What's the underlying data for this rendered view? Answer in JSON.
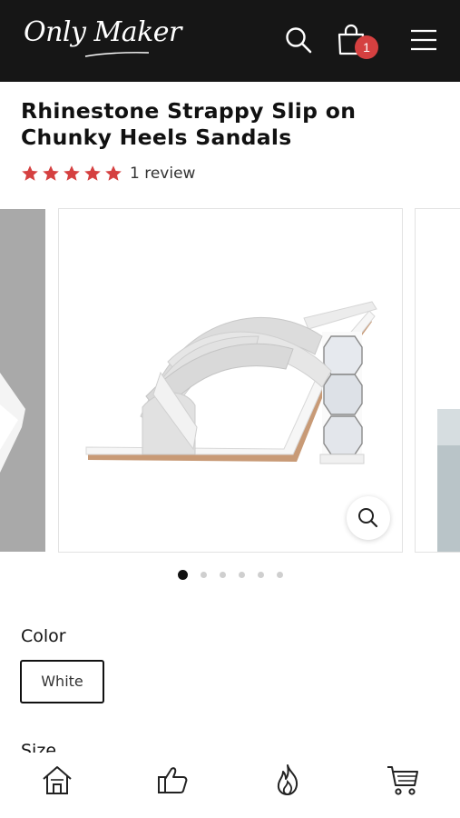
{
  "header": {
    "logo_text": "Only Maker",
    "cart_count": "1",
    "icons": [
      "search-icon",
      "shopping-bag-icon",
      "hamburger-menu-icon"
    ],
    "background_color": "#161616",
    "badge_color": "#d54040"
  },
  "product": {
    "title": "Rhinestone Strappy Slip on Chunky Heels Sandals",
    "rating": 5,
    "rating_max": 5,
    "review_text": "1 review",
    "star_color": "#d54040"
  },
  "gallery": {
    "slide_count": 6,
    "active_index": 0,
    "zoom_icon": "magnifier-icon"
  },
  "options": {
    "color_label": "Color",
    "color_value": "White",
    "size_label": "Size"
  },
  "bottom_nav": {
    "icons": [
      "home-icon",
      "thumbs-up-icon",
      "flame-icon",
      "cart-icon"
    ]
  }
}
